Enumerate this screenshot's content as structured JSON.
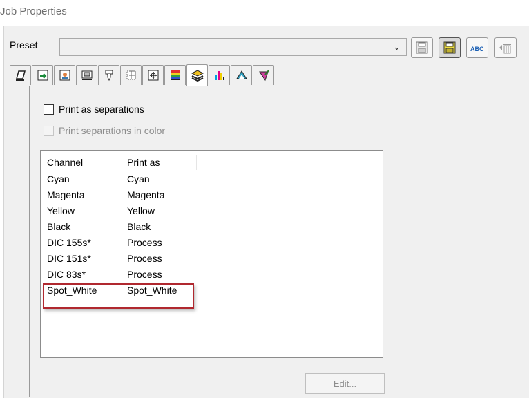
{
  "window": {
    "title": "Job Properties"
  },
  "preset": {
    "label": "Preset",
    "value": ""
  },
  "toolbar": {
    "icons": [
      "save-preset-icon",
      "save-as-preset-icon",
      "rename-preset-icon",
      "delete-preset-icon"
    ],
    "rename_text": "ABC"
  },
  "tabs": [
    "media-tab-icon",
    "layout-tab-icon",
    "image-tab-icon",
    "printer-tab-icon",
    "nozzle-tab-icon",
    "grid-tab-icon",
    "marks-tab-icon",
    "color-bars-tab-icon",
    "separations-tab-icon",
    "color-channels-tab-icon",
    "profile-tab-icon",
    "color-edit-tab-icon"
  ],
  "active_tab": 8,
  "separations": {
    "print_as_separations": {
      "label": "Print as separations",
      "checked": false
    },
    "print_in_color": {
      "label": "Print separations in color",
      "checked": false,
      "disabled": true
    }
  },
  "channels": {
    "headers": [
      "Channel",
      "Print as"
    ],
    "rows": [
      [
        "Cyan",
        "Cyan"
      ],
      [
        "Magenta",
        "Magenta"
      ],
      [
        "Yellow",
        "Yellow"
      ],
      [
        "Black",
        "Black"
      ],
      [
        "DIC 155s*",
        "Process"
      ],
      [
        "DIC 151s*",
        "Process"
      ],
      [
        "DIC 83s*",
        "Process"
      ],
      [
        "Spot_White",
        "Spot_White"
      ]
    ],
    "highlighted_row": 7
  },
  "edit_button": {
    "label": "Edit...",
    "disabled": true
  },
  "colors": {
    "highlight": "#b0282f",
    "panel_bg": "#f0f0f0"
  }
}
